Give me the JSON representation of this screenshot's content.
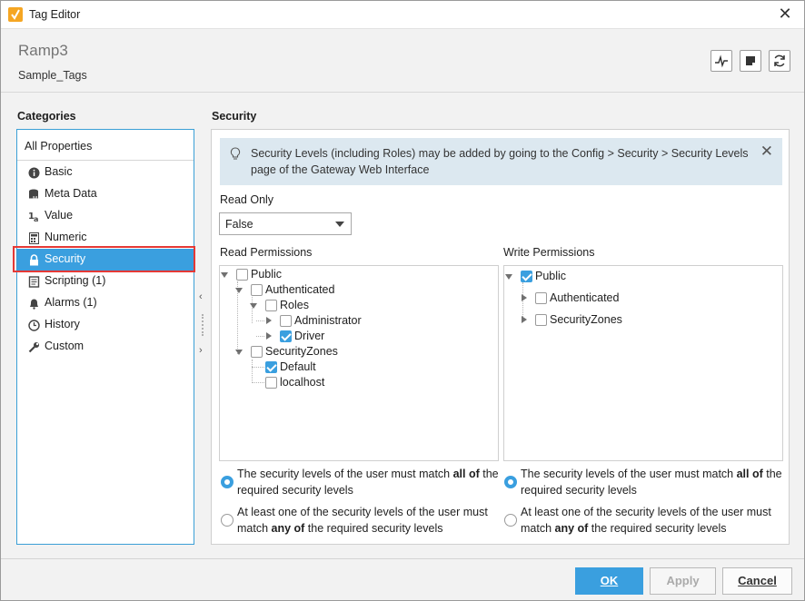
{
  "window": {
    "title": "Tag Editor"
  },
  "header": {
    "tag_name": "Ramp3",
    "provider": "Sample_Tags"
  },
  "categories": {
    "title": "Categories",
    "all_label": "All Properties",
    "items": [
      {
        "label": "Basic",
        "icon": "info-icon"
      },
      {
        "label": "Meta Data",
        "icon": "metadata-icon"
      },
      {
        "label": "Value",
        "icon": "value-icon"
      },
      {
        "label": "Numeric",
        "icon": "calculator-icon"
      },
      {
        "label": "Security",
        "icon": "lock-icon",
        "selected": true
      },
      {
        "label": "Scripting (1)",
        "icon": "script-icon"
      },
      {
        "label": "Alarms (1)",
        "icon": "bell-icon"
      },
      {
        "label": "History",
        "icon": "clock-icon"
      },
      {
        "label": "Custom",
        "icon": "wrench-icon"
      }
    ]
  },
  "security": {
    "title": "Security",
    "info": "Security Levels (including Roles) may be added by going to the Config > Security > Security Levels page of the Gateway Web Interface",
    "read_only_label": "Read Only",
    "read_only_value": "False",
    "read_permissions_label": "Read Permissions",
    "write_permissions_label": "Write Permissions",
    "read_tree": [
      {
        "label": "Public",
        "checked": false
      },
      {
        "label": "Authenticated",
        "checked": false
      },
      {
        "label": "Roles",
        "checked": false
      },
      {
        "label": "Administrator",
        "checked": false
      },
      {
        "label": "Driver",
        "checked": true
      },
      {
        "label": "SecurityZones",
        "checked": false
      },
      {
        "label": "Default",
        "checked": true
      },
      {
        "label": "localhost",
        "checked": false
      }
    ],
    "write_tree": [
      {
        "label": "Public",
        "checked": true
      },
      {
        "label": "Authenticated",
        "checked": false
      },
      {
        "label": "SecurityZones",
        "checked": false
      }
    ],
    "match_all": {
      "pre": "The security levels of the user must match ",
      "bold": "all of",
      "post": " the required security levels"
    },
    "match_any": {
      "pre": "At least one of the security levels of the user must match ",
      "bold": "any of",
      "post": " the required security levels"
    },
    "read_match_selected": "all",
    "write_match_selected": "all"
  },
  "footer": {
    "ok": "OK",
    "apply": "Apply",
    "cancel": "Cancel"
  }
}
